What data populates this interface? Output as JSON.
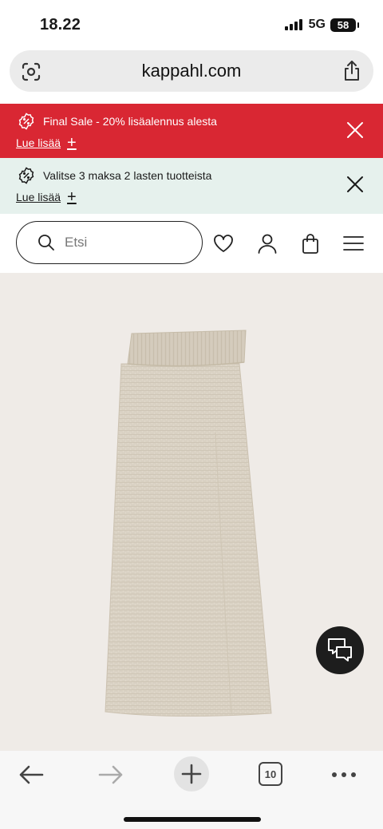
{
  "status": {
    "time": "18.22",
    "network": "5G",
    "battery": "58"
  },
  "browser": {
    "url": "kappahl.com"
  },
  "banners": [
    {
      "title": "Final Sale - 20% lisäalennus alesta",
      "link": "Lue lisää",
      "bg": "#d92733"
    },
    {
      "title": "Valitse 3 maksa 2 lasten tuotteista",
      "link": "Lue lisää",
      "bg": "#e6f1ed"
    }
  ],
  "header": {
    "search_placeholder": "Etsi"
  },
  "product": {
    "image": "knit-maxi-skirt-beige",
    "color": "#d9d1c3"
  },
  "toolbar": {
    "tab_count": "10"
  },
  "icons": [
    "lens-icon",
    "share-icon",
    "discount-icon",
    "close-icon",
    "search-icon",
    "heart-icon",
    "account-icon",
    "bag-icon",
    "menu-icon",
    "chat-icon",
    "back-icon",
    "forward-icon",
    "plus-icon",
    "more-icon"
  ]
}
